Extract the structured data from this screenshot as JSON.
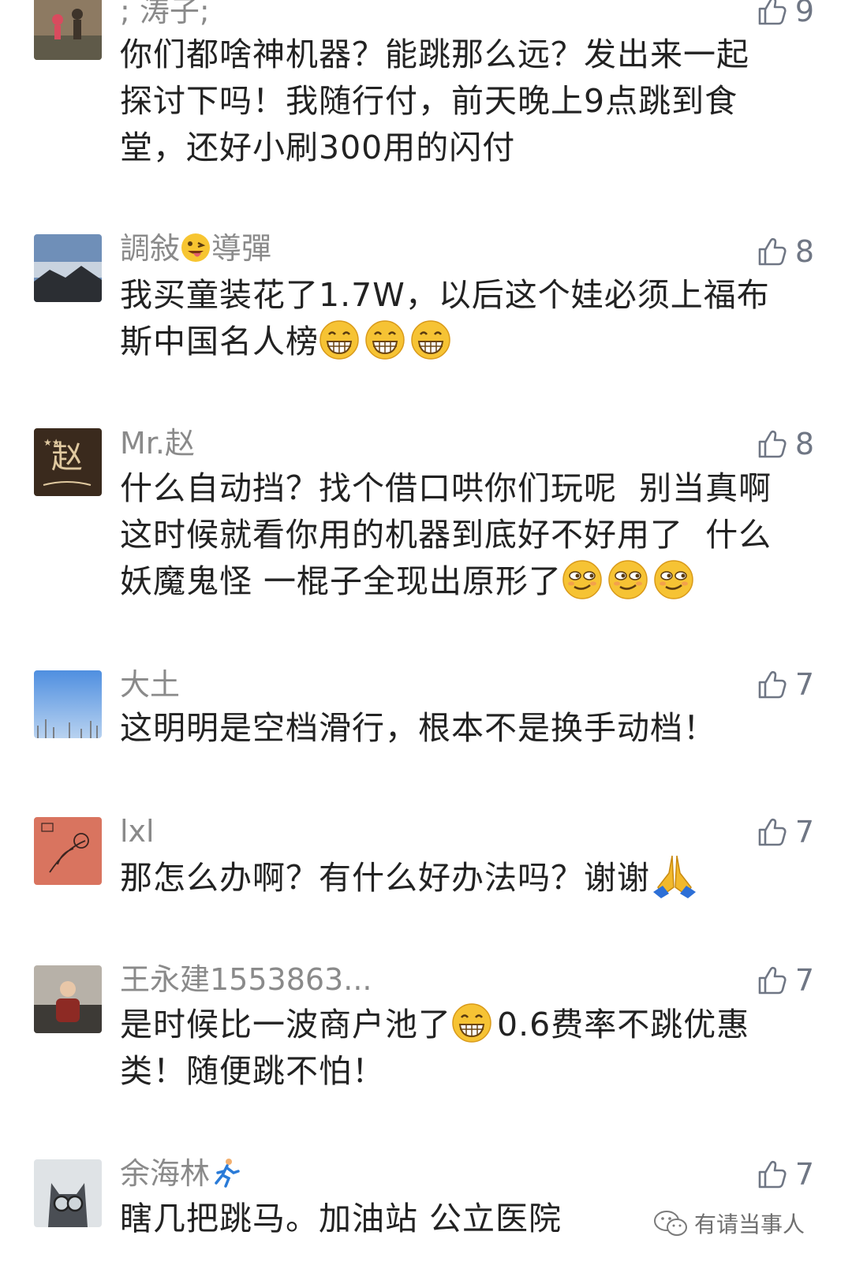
{
  "comments": [
    {
      "nickname": "; 涛子;",
      "likes": "9",
      "lines": [
        "你们都啥神机器？能跳那么远？发出来一起",
        "探讨下吗！我随行付，前天晚上9点跳到食",
        "堂，还好小刷300用的闪付"
      ]
    },
    {
      "nickname_a": "調敍",
      "nickname_b": "導彈",
      "likes": "8",
      "lines": [
        "我买童装花了1.7W，以后这个娃必须上福布",
        "斯中国名人榜"
      ]
    },
    {
      "nickname": "Mr.赵",
      "likes": "8",
      "lines": [
        "什么自动挡？找个借口哄你们玩呢  别当真啊",
        "这时候就看你用的机器到底好不好用了  什么",
        "妖魔鬼怪 一棍子全现出原形了"
      ]
    },
    {
      "nickname": "大土",
      "likes": "7",
      "lines": [
        "这明明是空档滑行，根本不是换手动档！"
      ]
    },
    {
      "nickname": "lxl",
      "likes": "7",
      "lines": [
        "那怎么办啊？有什么好办法吗？谢谢"
      ]
    },
    {
      "nickname": "王永建1553863...",
      "likes": "7",
      "line1_a": "是时候比一波商户池了",
      "line1_b": "0.6费率不跳优惠",
      "line2": "类！随便跳不怕！"
    },
    {
      "nickname": "余海林",
      "likes": "7",
      "lines": [
        "瞎几把跳马。加油站 公立医院"
      ]
    }
  ],
  "watermark": "有请当事人",
  "icons": {
    "like": "thumbs-up-icon",
    "grin": "grinning-emoji",
    "smirk": "smirk-emoji",
    "pray": "pray-emoji",
    "runner": "running-emoji",
    "wechat": "wechat-icon"
  }
}
